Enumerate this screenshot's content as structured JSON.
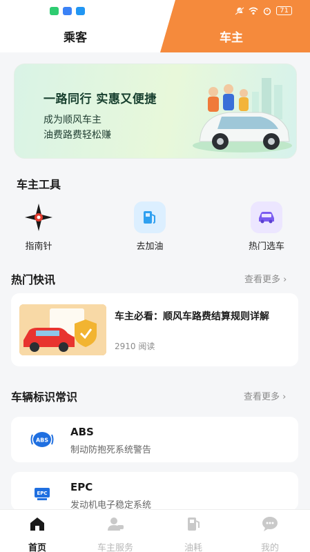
{
  "header": {
    "tabs": [
      {
        "label": "乘客"
      },
      {
        "label": "车主"
      }
    ],
    "battery": "71",
    "status_icons": [
      "app-icon-green",
      "cloud-icon",
      "search-app-icon",
      "mute-icon",
      "wifi-icon",
      "alarm-icon",
      "battery-icon"
    ],
    "accent_color": "#f58a3c"
  },
  "banner": {
    "title": "一路同行 实惠又便捷",
    "line1": "成为顺风车主",
    "line2": "油费路费轻松赚"
  },
  "tools": {
    "heading": "车主工具",
    "items": [
      {
        "label": "指南针",
        "icon": "compass-icon"
      },
      {
        "label": "去加油",
        "icon": "fuel-pump-icon"
      },
      {
        "label": "热门选车",
        "icon": "car-icon"
      }
    ]
  },
  "news": {
    "heading": "热门快讯",
    "more": "查看更多",
    "items": [
      {
        "title": "车主必看：顺风车路费结算规则详解",
        "reads": "2910 阅读"
      }
    ]
  },
  "signs": {
    "heading": "车辆标识常识",
    "more": "查看更多",
    "items": [
      {
        "code": "ABS",
        "desc": "制动防抱死系统警告"
      },
      {
        "code": "EPC",
        "desc": "发动机电子稳定系统"
      }
    ]
  },
  "nav": {
    "items": [
      {
        "label": "首页",
        "icon": "home-icon",
        "active": true
      },
      {
        "label": "车主服务",
        "icon": "driver-service-icon"
      },
      {
        "label": "油耗",
        "icon": "fuel-icon"
      },
      {
        "label": "我的",
        "icon": "profile-chat-icon"
      }
    ]
  }
}
